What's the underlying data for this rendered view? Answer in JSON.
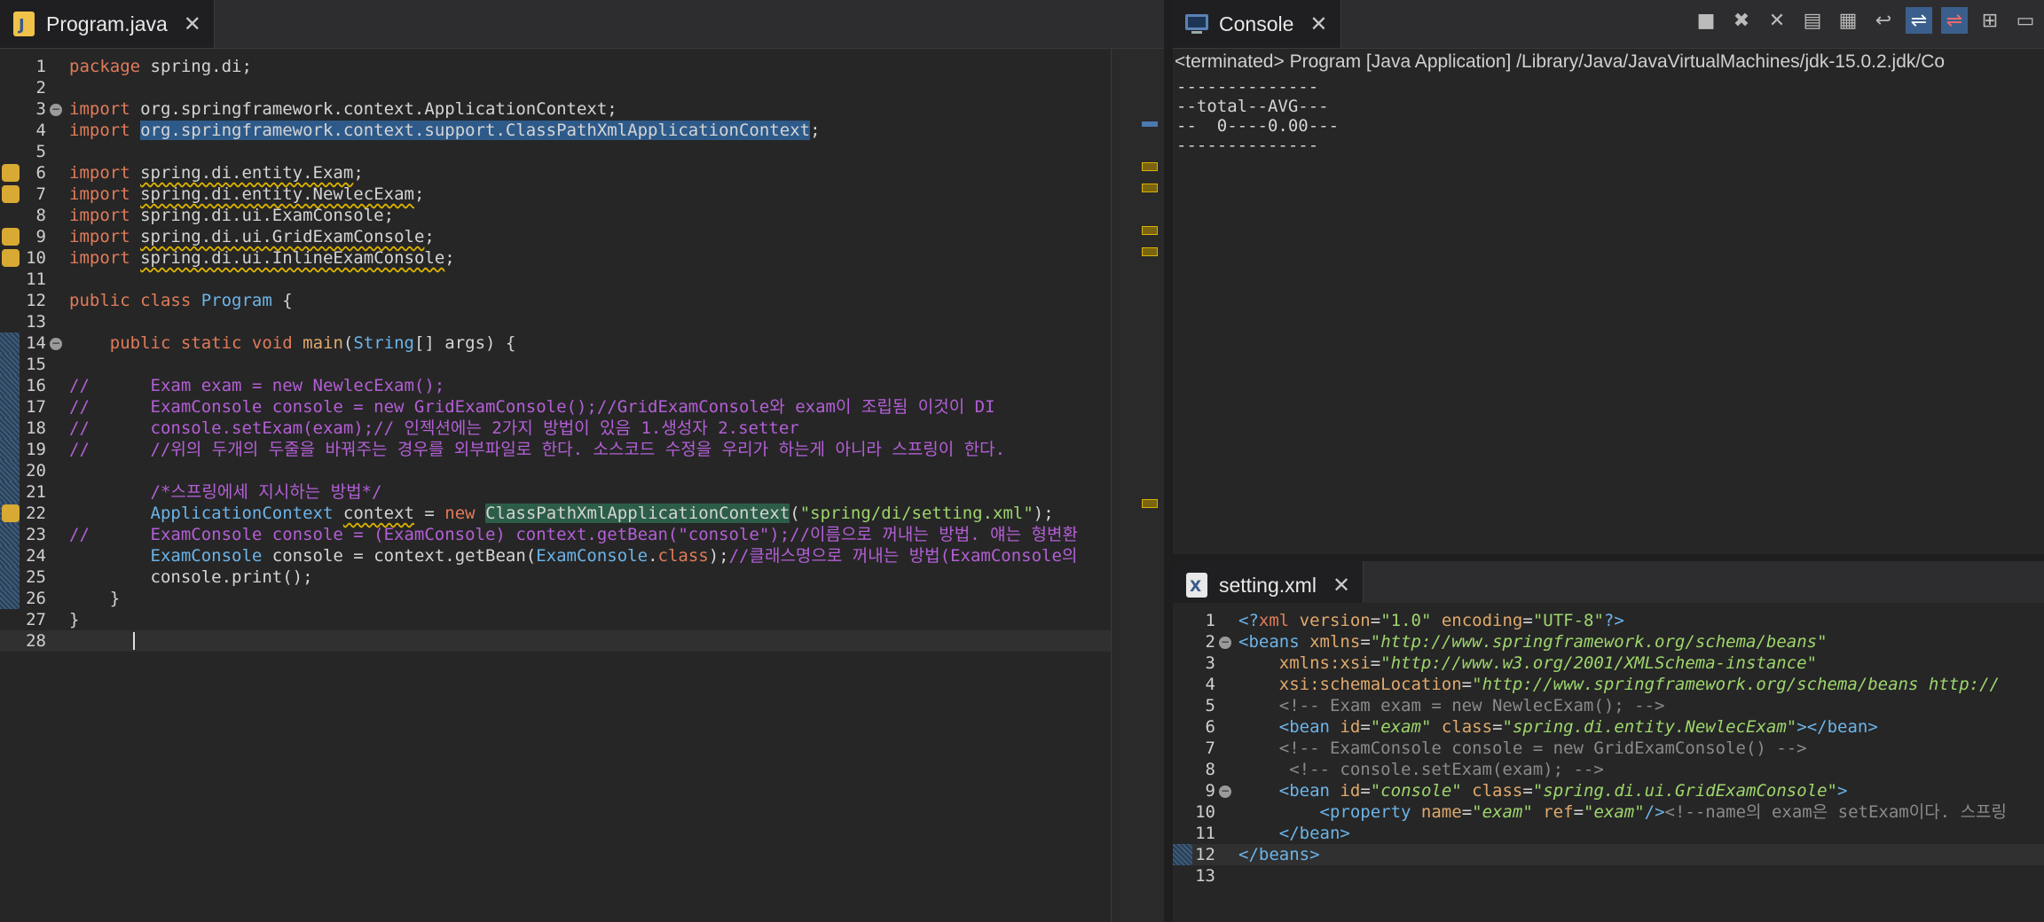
{
  "left_editor": {
    "tab_title": "Program.java",
    "lines": [
      {
        "n": "1",
        "html": "<span class='kw'>package</span> spring.di;"
      },
      {
        "n": "2",
        "html": ""
      },
      {
        "n": "3",
        "html": "<span class='kw'>import</span> org.springframework.context.ApplicationContext;",
        "fold": "−"
      },
      {
        "n": "4",
        "html": "<span class='kw'>import</span> <span class='hl'>org.springframework.context.support.ClassPathXmlApplicationContext</span>;"
      },
      {
        "n": "5",
        "html": ""
      },
      {
        "n": "6",
        "html": "<span class='kw'>import</span> <span class='warn'>spring.di.entity.Exam</span>;",
        "warn": true
      },
      {
        "n": "7",
        "html": "<span class='kw'>import</span> <span class='warn'>spring.di.entity.NewlecExam</span>;",
        "warn": true
      },
      {
        "n": "8",
        "html": "<span class='kw'>import</span> spring.di.ui.ExamConsole;"
      },
      {
        "n": "9",
        "html": "<span class='kw'>import</span> <span class='warn'>spring.di.ui.GridExamConsole</span>;",
        "warn": true
      },
      {
        "n": "10",
        "html": "<span class='kw'>import</span> <span class='warn'>spring.di.ui.InlineExamConsole</span>;",
        "warn": true
      },
      {
        "n": "11",
        "html": ""
      },
      {
        "n": "12",
        "html": "<span class='kw'>public class</span> <span class='cls'>Program</span> {"
      },
      {
        "n": "13",
        "html": ""
      },
      {
        "n": "14",
        "html": "    <span class='kw'>public static void</span> <span class='fn'>main</span>(<span class='cls'>String</span>[] args) {",
        "fold": "−",
        "bm": true
      },
      {
        "n": "15",
        "html": "",
        "bm": true
      },
      {
        "n": "16",
        "html": "<span class='cmt'>//      Exam exam = new NewlecExam();</span>",
        "bm": true
      },
      {
        "n": "17",
        "html": "<span class='cmt'>//      ExamConsole console = new GridExamConsole();//GridExamConsole와 exam이 조립됨 이것이 DI</span>",
        "bm": true
      },
      {
        "n": "18",
        "html": "<span class='cmt'>//      console.setExam(exam);// 인젝션에는 2가지 방법이 있음 1.생성자 2.setter</span>",
        "bm": true
      },
      {
        "n": "19",
        "html": "<span class='cmt'>//      //위의 두개의 두줄을 바꿔주는 경우를 외부파일로 한다. 소스코드 수정을 우리가 하는게 아니라 스프링이 한다.</span>",
        "bm": true
      },
      {
        "n": "20",
        "html": "",
        "bm": true
      },
      {
        "n": "21",
        "html": "        <span class='cmt'>/*스프링에세 지시하는 방법*/</span>",
        "bm": true
      },
      {
        "n": "22",
        "html": "        <span class='cls'>ApplicationContext</span> <span class='warn'>context</span> = <span class='kw'>new</span> <span class='hlg'>ClassPathXmlApplicationContext</span>(<span class='str'>\"spring/di/setting.xml\"</span>);",
        "warn": true,
        "bm": true
      },
      {
        "n": "23",
        "html": "<span class='cmt'>//      ExamConsole console = (ExamConsole) context.getBean(\"console\");//이름으로 꺼내는 방법. 얘는 형변환</span>",
        "bm": true
      },
      {
        "n": "24",
        "html": "        <span class='cls'>ExamConsole</span> console = context.getBean(<span class='cls'>ExamConsole</span>.<span class='kw'>class</span>);<span class='cmt'>//클래스명으로 꺼내는 방법(ExamConsole의</span>",
        "bm": true
      },
      {
        "n": "25",
        "html": "        console.print();",
        "bm": true
      },
      {
        "n": "26",
        "html": "    }",
        "bm": true
      },
      {
        "n": "27",
        "html": "}"
      },
      {
        "n": "28",
        "html": "    ",
        "active": true
      }
    ]
  },
  "console": {
    "tab_title": "Console",
    "status": "<terminated> Program [Java Application] /Library/Java/JavaVirtualMachines/jdk-15.0.2.jdk/Co",
    "output": "--------------\n--total--AVG---\n--  0----0.00---\n--------------"
  },
  "xml_editor": {
    "tab_title": "setting.xml",
    "lines": [
      {
        "n": "1",
        "html": "<span class='cls'>&lt;?</span><span class='kw'>xml</span> <span class='fn'>version</span>=<span class='str'>\"1.0\"</span> <span class='fn'>encoding</span>=<span class='str'>\"UTF-8\"</span><span class='cls'>?&gt;</span>"
      },
      {
        "n": "2",
        "html": "<span class='cls'>&lt;</span><span class='cls'>beans</span> <span class='fn'>xmlns</span>=<span class='str'><i>\"http://www.springframework.org/schema/beans\"</i></span>",
        "fold": "−"
      },
      {
        "n": "3",
        "html": "    <span class='fn'>xmlns:xsi</span>=<span class='str'><i>\"http://www.w3.org/2001/XMLSchema-instance\"</i></span>"
      },
      {
        "n": "4",
        "html": "    <span class='fn'>xsi:schemaLocation</span>=<span class='str'><i>\"http://www.springframework.org/schema/beans http://</i></span>"
      },
      {
        "n": "5",
        "html": "    <span class='xcmt'>&lt;!-- Exam exam = new NewlecExam(); --&gt;</span>"
      },
      {
        "n": "6",
        "html": "    <span class='cls'>&lt;bean</span> <span class='fn'>id</span>=<span class='str'><i>\"exam\"</i></span> <span class='fn'>class</span>=<span class='str'><i>\"spring.di.entity.NewlecExam\"</i></span><span class='cls'>&gt;&lt;/bean&gt;</span>"
      },
      {
        "n": "7",
        "html": "    <span class='xcmt'>&lt;!-- ExamConsole console = new GridExamConsole() --&gt;</span>"
      },
      {
        "n": "8",
        "html": "     <span class='xcmt'>&lt;!-- console.setExam(exam); --&gt;</span>"
      },
      {
        "n": "9",
        "html": "    <span class='cls'>&lt;bean</span> <span class='fn'>id</span>=<span class='str'><i>\"console\"</i></span> <span class='fn'>class</span>=<span class='str'><i>\"spring.di.ui.GridExamConsole\"</i></span><span class='cls'>&gt;</span>",
        "fold": "−"
      },
      {
        "n": "10",
        "html": "        <span class='cls'>&lt;property</span> <span class='fn'>name</span>=<span class='str'><i>\"exam\"</i></span> <span class='fn'>ref</span>=<span class='str'><i>\"exam\"</i></span><span class='cls'>/&gt;</span><span class='xcmt'>&lt;!--name의 exam은 setExam이다. 스프링</span>"
      },
      {
        "n": "11",
        "html": "    <span class='cls'>&lt;/bean&gt;</span>"
      },
      {
        "n": "12",
        "html": "<span class='cls'>&lt;/beans&gt;</span>",
        "active": true,
        "bm": true
      },
      {
        "n": "13",
        "html": ""
      }
    ]
  }
}
